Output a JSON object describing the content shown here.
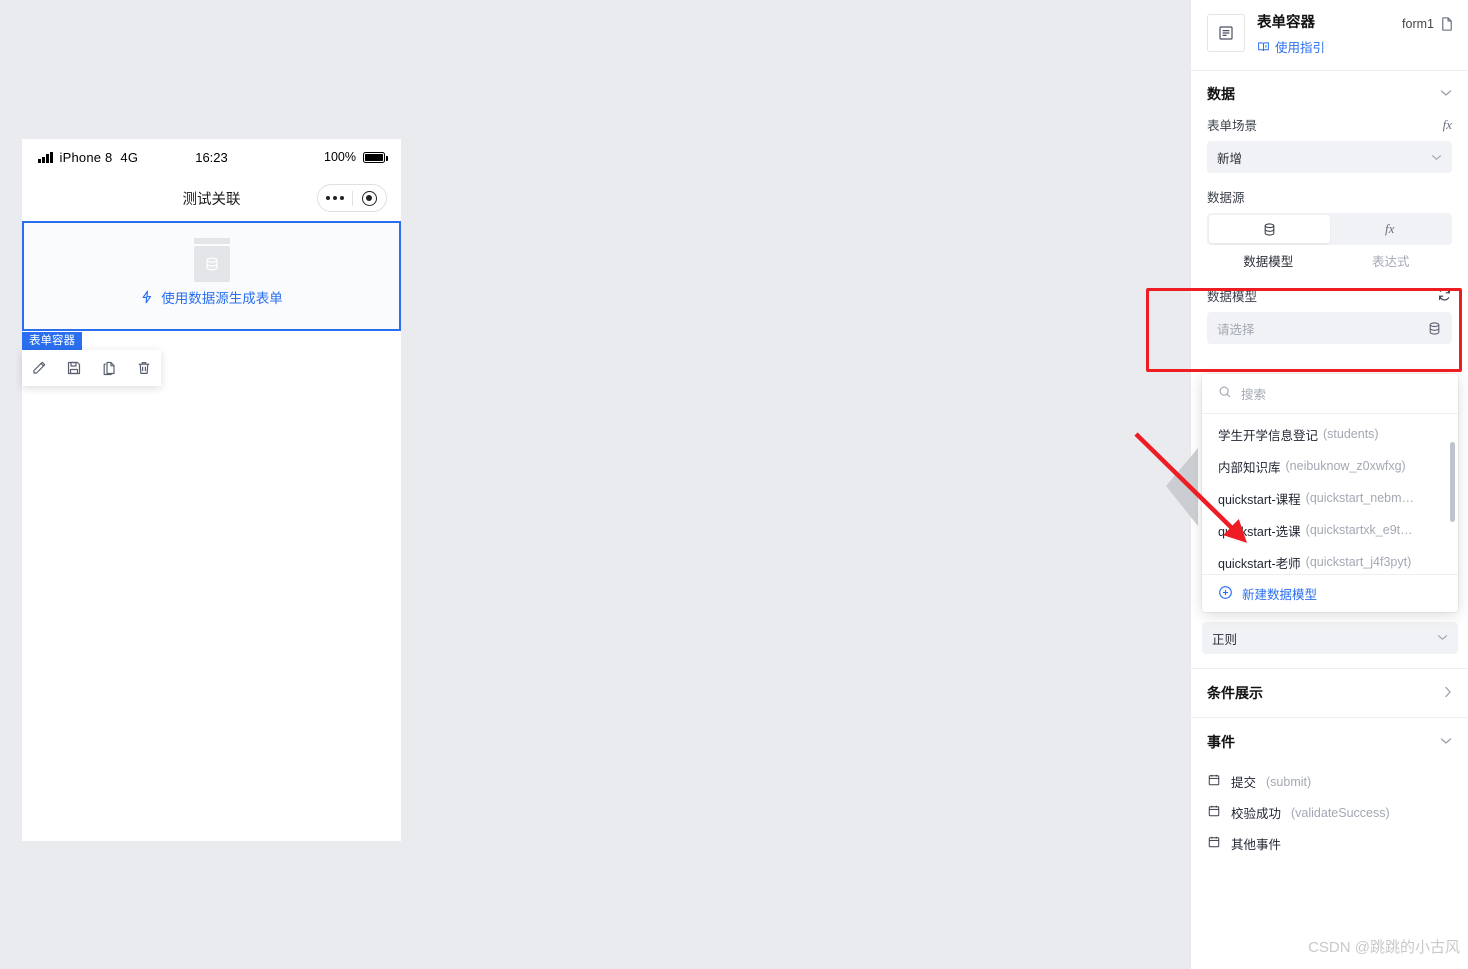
{
  "phone": {
    "status": {
      "device": "iPhone 8",
      "network": "4G",
      "time": "16:23",
      "battery": "100%"
    },
    "nav_title": "测试关联",
    "form_container": {
      "datasource_link": "使用数据源生成表单",
      "tag_label": "表单容器"
    },
    "toolbar": {
      "edit": "edit-pencil",
      "save": "save-floppy",
      "copy": "copy-pages",
      "delete": "trash-bin"
    }
  },
  "panel": {
    "header": {
      "title": "表单容器",
      "guide_label": "使用指引",
      "form_name": "form1"
    },
    "data_section": {
      "title": "数据",
      "scene_label": "表单场景",
      "scene_value": "新增",
      "datasource_label": "数据源",
      "seg_tabs": [
        {
          "label": "数据模型",
          "icon": "database-icon",
          "active": true
        },
        {
          "label": "表达式",
          "icon": "fx-icon",
          "active": false
        }
      ],
      "model_label": "数据模型",
      "model_placeholder": "请选择",
      "refresh_icon": "refresh-icon",
      "database_icon": "database-icon"
    },
    "dropdown": {
      "search_placeholder": "搜索",
      "items": [
        {
          "name": "学生开学信息登记",
          "code": "(students)"
        },
        {
          "name": "内部知识库",
          "code": "(neibuknow_z0xwfxg)"
        },
        {
          "name": "quickstart-课程",
          "code": "(quickstart_nebm…"
        },
        {
          "name": "quickstart-选课",
          "code": "(quickstartxk_e9t…"
        },
        {
          "name": "quickstart-老师",
          "code": "(quickstart_j4f3pyt)"
        }
      ],
      "create_label": "新建数据模型"
    },
    "hidden_field_value": "正则",
    "condition_section": {
      "title": "条件展示"
    },
    "event_section": {
      "title": "事件",
      "items": [
        {
          "label": "提交",
          "code": "(submit)"
        },
        {
          "label": "校验成功",
          "code": "(validateSuccess)"
        },
        {
          "label": "其他事件",
          "code": ""
        }
      ]
    }
  },
  "watermark": "CSDN @跳跳的小古风",
  "colors": {
    "accent": "#2a6ff0",
    "annotation": "#ee1d23",
    "canvas_bg": "#eaebef",
    "panel_bg": "#ffffff",
    "field_bg": "#f1f2f5"
  }
}
